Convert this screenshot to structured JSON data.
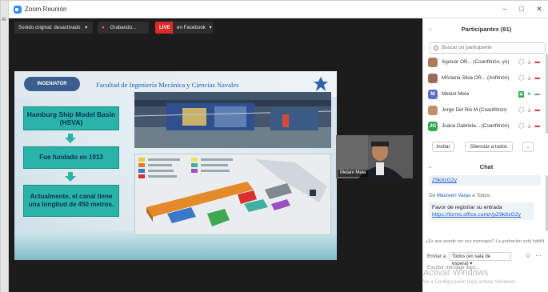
{
  "window": {
    "title": "Zoom Reunión",
    "edge_label": "AI"
  },
  "topbar": {
    "original_sound": "Sonido original: desactivado",
    "recording": "Grabando...",
    "live_badge": "LIVE",
    "facebook": "en Facebook"
  },
  "slide": {
    "logo_text": "INGENIATOR",
    "faculty": "Facultad de Ingeniería Mecánica y Ciencias Navales",
    "box1": "Hamburg Ship Model Basin (HSVA)",
    "box2": "Fue fundado en 1913",
    "box3": "Actualmente, el canal tiene una longitud de 450 metros."
  },
  "video": {
    "name": "Melani Mela"
  },
  "participants": {
    "title": "Participantes (91)",
    "search_placeholder": "Buscar un participante",
    "list": [
      {
        "initial": "",
        "name": "Aguivar OR... (Coanfitrión, yo)",
        "avatar_color": "#b07a5a"
      },
      {
        "initial": "",
        "name": "MAriana Silva OR... (Anfitrión)",
        "avatar_color": "#9c6b58"
      },
      {
        "initial": "M",
        "name": "Melani Mela",
        "avatar_color": "#5b6fc2"
      },
      {
        "initial": "",
        "name": "Jorge Del Rio M (Coanfitrión)",
        "avatar_color": "#c28e6e"
      },
      {
        "initial": "JG",
        "name": "Juana Gabriela... (Coanfitrión)",
        "avatar_color": "#2fa84f"
      }
    ],
    "invite_button": "Invitar",
    "mute_all_button": "Silenciar a todos",
    "more_button": "..."
  },
  "chat": {
    "title": "Chat",
    "prev_link_tail": "Z9k8zG2y",
    "from_label": "De",
    "from_name": "Maureen Varas",
    "to_label": "a Todos:",
    "message_text": "Favor de registrar su entrada",
    "message_link": "https://forms.office.com/r/pZ9k8zG2y",
    "notice": "¿Es que puede ver sus mensajes? La grabación está habilit",
    "send_to_label": "Enviar a:",
    "send_to_value": "Todos (en sala de espera)",
    "input_placeholder": "Escribir mensaje aquí...",
    "watermark_title": "Activar Windows",
    "watermark_sub": "Ve a Configuración para activar Windows."
  }
}
